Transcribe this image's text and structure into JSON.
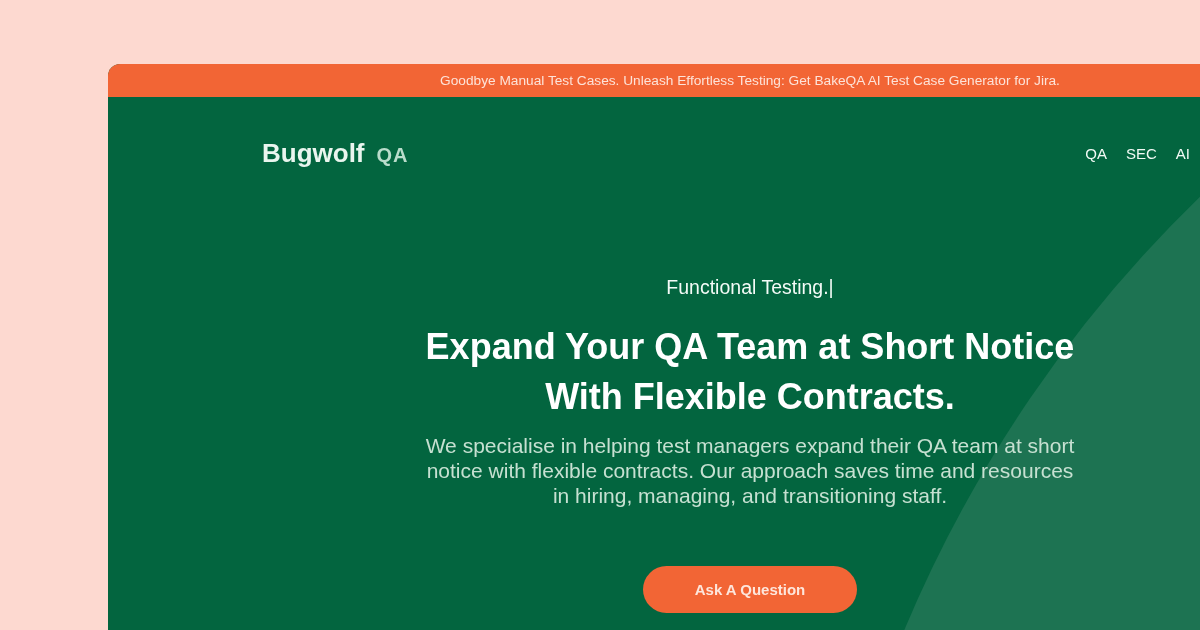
{
  "announcement_bar": {
    "text": "Goodbye Manual Test Cases. Unleash Effortless Testing: Get BakeQA AI Test Case Generator for Jira."
  },
  "header": {
    "logo": {
      "name": "Bugwolf",
      "suffix": "QA"
    },
    "nav": [
      {
        "label": "QA"
      },
      {
        "label": "SEC"
      },
      {
        "label": "AI"
      }
    ]
  },
  "hero": {
    "typed_text": "Functional Testing.|",
    "headline": [
      "Expand Your QA Team at Short Notice",
      "With Flexible Contracts."
    ],
    "description": "We specialise in helping test managers expand their QA team at short notice with flexible contracts. Our approach saves time and resources in hiring, managing, and transitioning staff.",
    "button": "Ask A Question"
  }
}
